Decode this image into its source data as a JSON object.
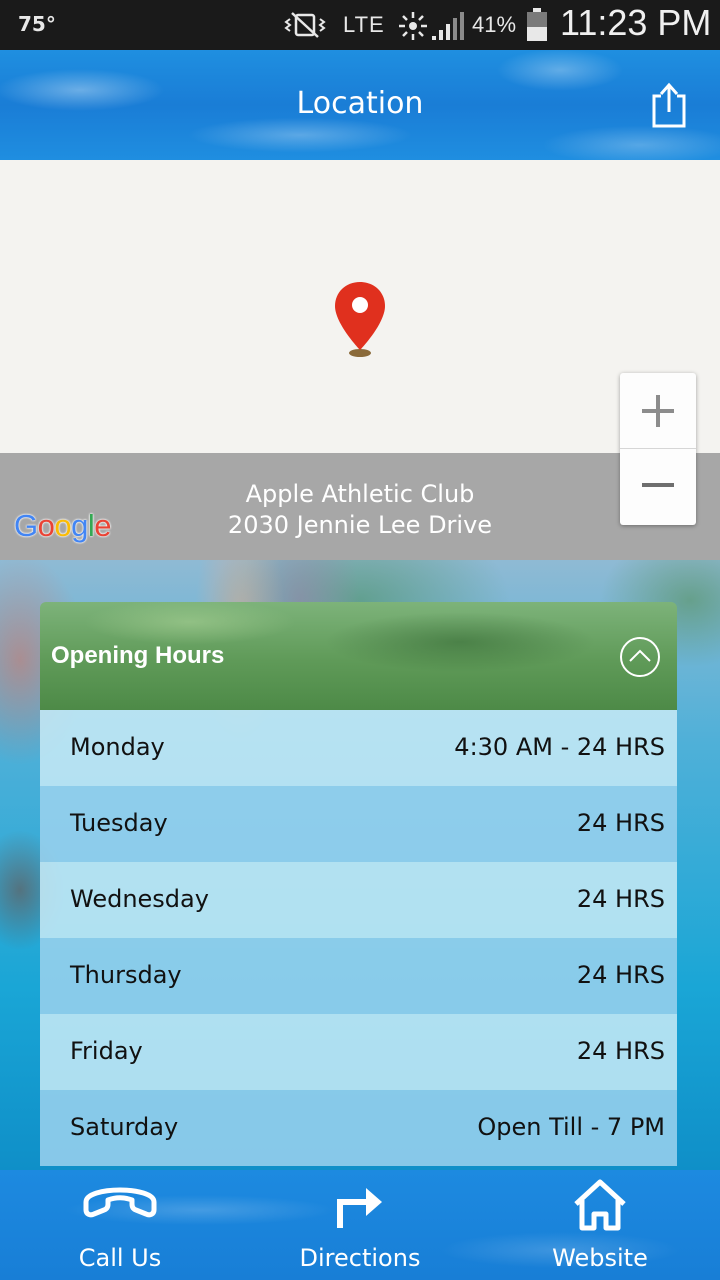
{
  "status_bar": {
    "temperature": "75°",
    "network": "LTE",
    "battery_percent": "41%",
    "time": "11:23 PM"
  },
  "header": {
    "title": "Location",
    "share_icon": "share-icon"
  },
  "map": {
    "provider": "Google",
    "place_name": "Apple Athletic Club",
    "address": "2030 Jennie Lee Drive",
    "zoom_in_icon": "plus-icon",
    "zoom_out_icon": "minus-icon",
    "pin_color": "#e0301e"
  },
  "hours": {
    "title": "Opening Hours",
    "rows": [
      {
        "day": "Monday",
        "time": "4:30 AM - 24 HRS"
      },
      {
        "day": "Tuesday",
        "time": "24 HRS"
      },
      {
        "day": "Wednesday",
        "time": "24 HRS"
      },
      {
        "day": "Thursday",
        "time": "24 HRS"
      },
      {
        "day": "Friday",
        "time": "24 HRS"
      },
      {
        "day": "Saturday",
        "time": "Open Till - 7 PM"
      }
    ]
  },
  "nav": {
    "items": [
      {
        "label": "Call Us",
        "icon": "phone-icon"
      },
      {
        "label": "Directions",
        "icon": "turn-right-arrow-icon"
      },
      {
        "label": "Website",
        "icon": "home-icon"
      }
    ]
  }
}
